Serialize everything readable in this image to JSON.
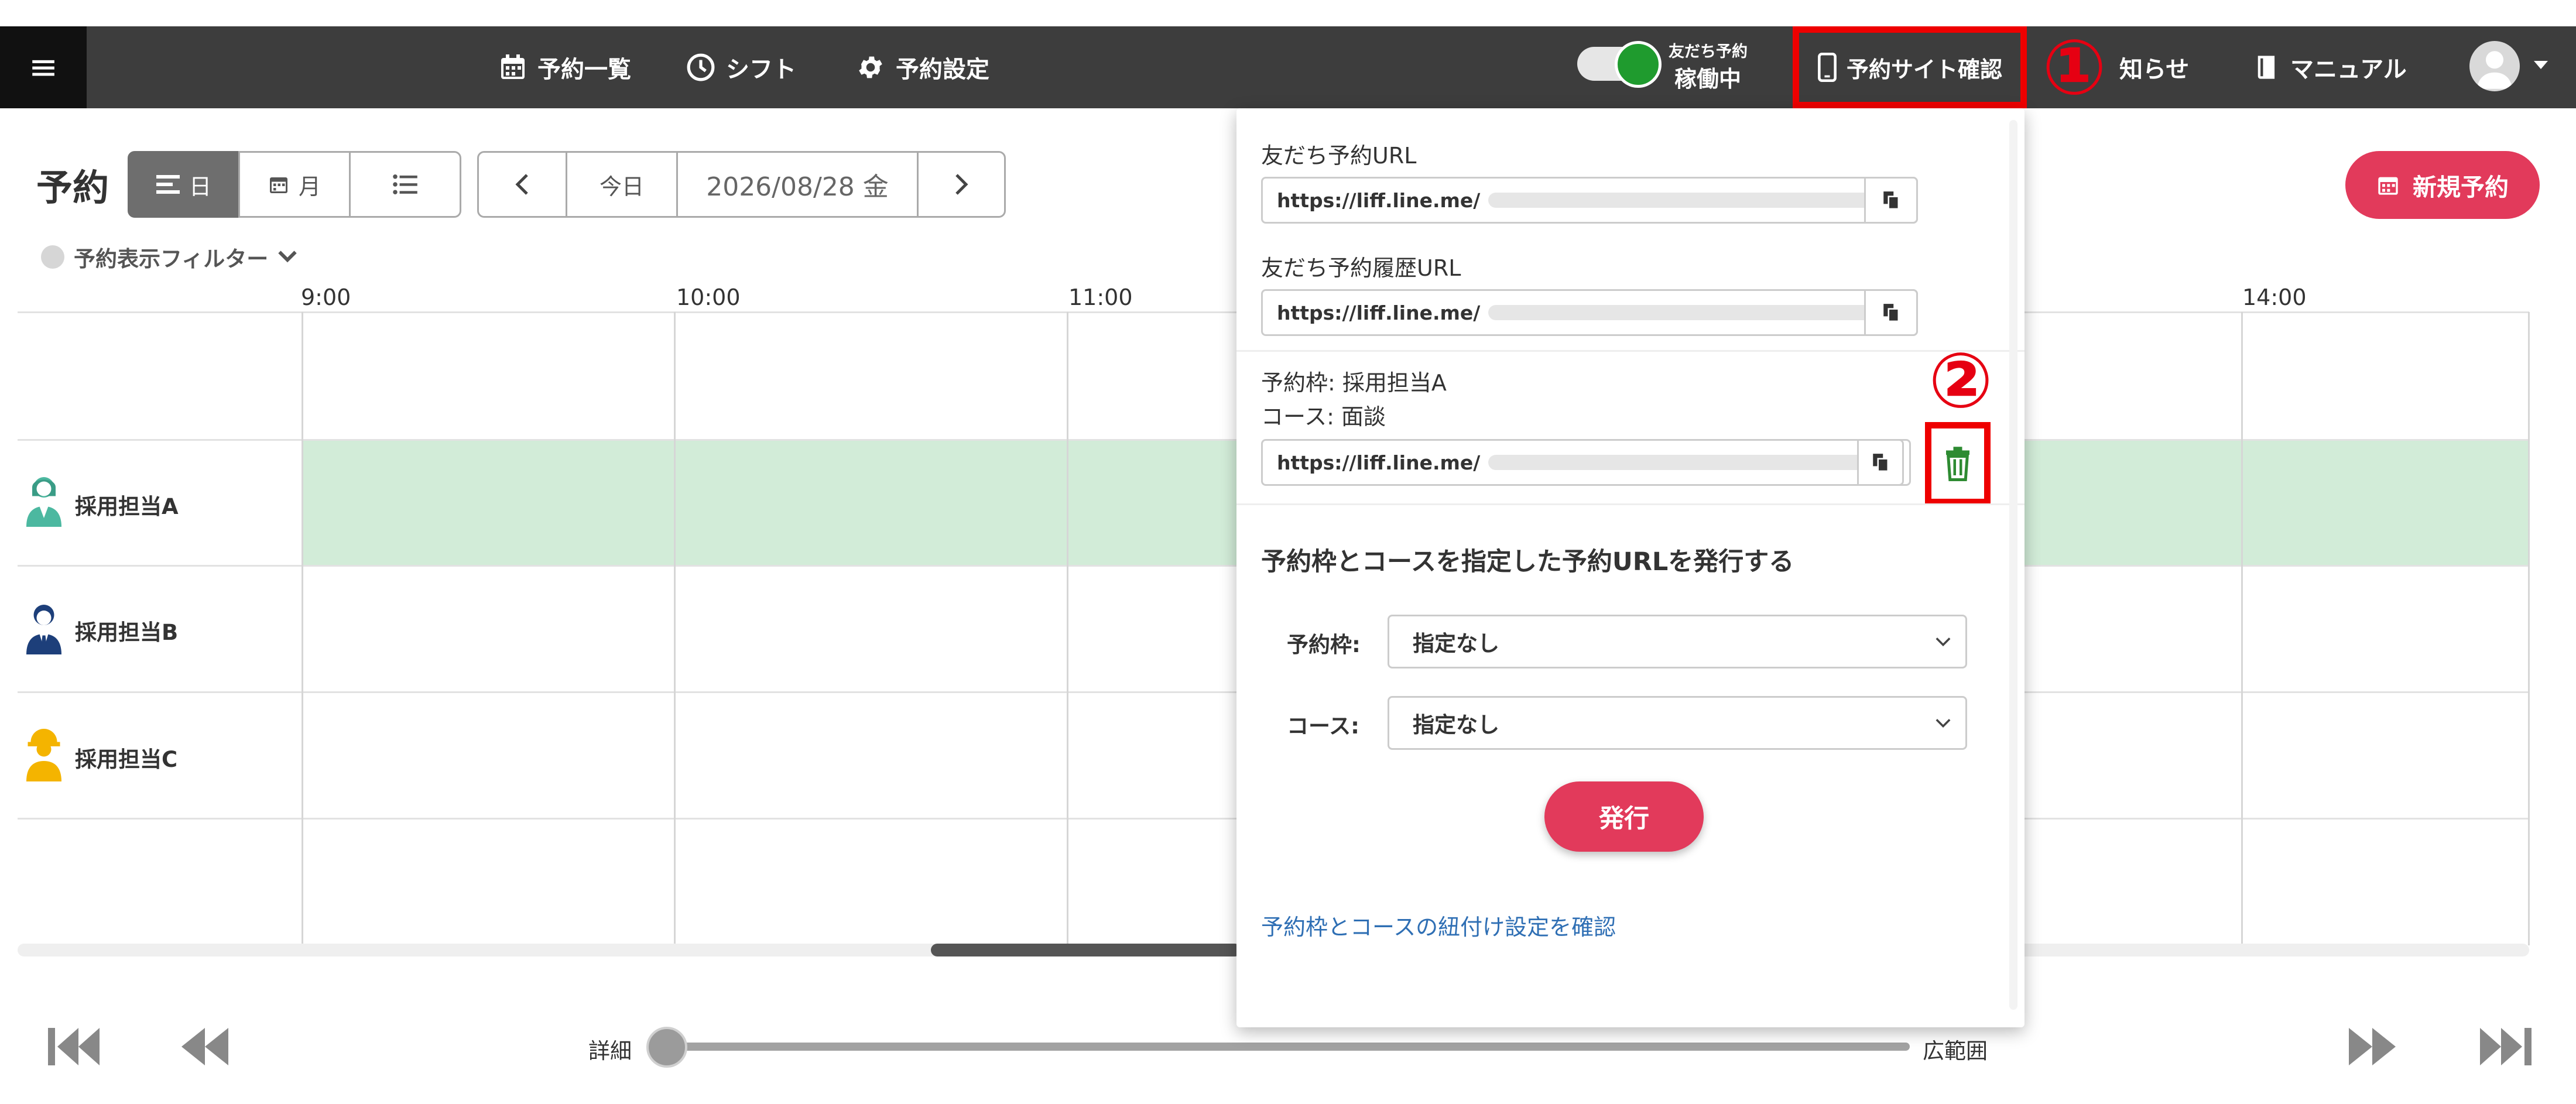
{
  "navbar": {
    "menu_icon": "hamburger-icon",
    "items": [
      {
        "label": "予約一覧",
        "icon": "calendar-icon"
      },
      {
        "label": "シフト",
        "icon": "clock-icon"
      },
      {
        "label": "予約設定",
        "icon": "gear-icon"
      }
    ],
    "toggle": {
      "caption": "友だち予約",
      "status": "稼働中",
      "on": true
    },
    "site_check": {
      "label": "予約サイト確認",
      "icon": "phone-icon"
    },
    "notice_partial": "知らせ",
    "manual": {
      "label": "マニュアル",
      "icon": "book-icon"
    },
    "avatar_icon": "user-avatar-icon"
  },
  "markers": {
    "one": "①",
    "two": "②"
  },
  "toolbar": {
    "title": "予約",
    "view_day": "日",
    "view_month": "月",
    "today": "今日",
    "date": "2026/08/28 金",
    "new_reservation": "新規予約",
    "filter": "予約表示フィルター"
  },
  "timeline": {
    "times": [
      "9:00",
      "10:00",
      "11:00",
      "14:00"
    ],
    "staff": [
      "採用担当A",
      "採用担当B",
      "採用担当C"
    ]
  },
  "zoom": {
    "left": "詳細",
    "right": "広範囲",
    "level": 0.0
  },
  "panel": {
    "friend_url_label": "友だち予約URL",
    "friend_url": "https://liff.line.me/",
    "history_url_label": "友だち予約履歴URL",
    "history_url": "https://liff.line.me/",
    "slot_line": "予約枠: 採用担当A",
    "course_line": "コース: 面談",
    "slot_url": "https://liff.line.me/",
    "issue_heading": "予約枠とコースを指定した予約URLを発行する",
    "slot_label": "予約枠:",
    "slot_value": "指定なし",
    "course_label": "コース:",
    "course_value": "指定なし",
    "issue_button": "発行",
    "settings_link": "予約枠とコースの紐付け設定を確認"
  },
  "colors": {
    "accent": "#e23a5b",
    "highlight": "#ee0000",
    "row_fill": "#d2ecd8",
    "link": "#2f6fb4",
    "toggle_on": "#1f9b2e"
  }
}
